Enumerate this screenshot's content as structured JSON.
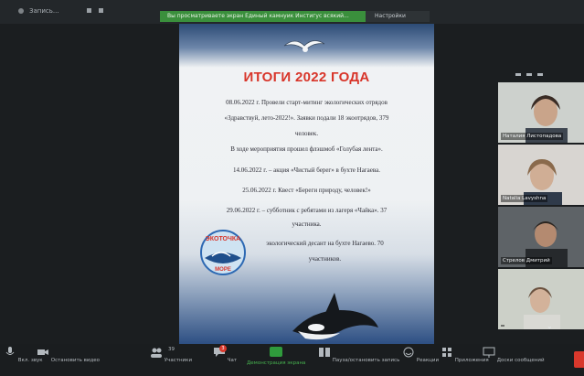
{
  "topbar": {
    "record_label": "Запись...",
    "share_banner": "Вы просматриваете экран Единый камнуик Инстигус всякий...",
    "view_options": "Настройки просмотра"
  },
  "slide": {
    "title": "ИТОГИ 2022 ГОДА",
    "lines": [
      "08.06.2022 г. Провели старт-митинг экологических отрядов",
      "«Здравствуй, лето-2022!». Заявки подали 18 экоотрядов, 379",
      "человек.",
      "В ходе мероприятия прошел флэшмоб «Голубая лента».",
      "14.06.2022 г. – акция «Чистый берег» в бухте Нагаева.",
      "25.06.2022 г. Квест «Береги природу, человек!»",
      "29.06.2022 г. – субботник с ребятами из лагеря «Чайка». 37",
      "участника.",
      "экологический десант на бухте Нагаево. 70",
      "участников."
    ],
    "logo_text_top": "ЭКОТОЧКА",
    "logo_text_bottom": "МОРЕ"
  },
  "participants": [
    {
      "name": "Наталия Листопадова"
    },
    {
      "name": "Natalia Lavyshna"
    },
    {
      "name": "Стрелов Дмитрий"
    },
    {
      "name": ""
    }
  ],
  "toolbar": {
    "mute": "Вкл. звук",
    "video": "Остановить видео",
    "participants": "Участники",
    "participants_count": "39",
    "chat": "Чат",
    "chat_badge": "3",
    "share": "Демонстрация экрана",
    "record": "Пауза/остановить запись",
    "reactions": "Реакции",
    "apps": "Приложения",
    "whiteboards": "Доски сообщений"
  },
  "colors": {
    "share_green": "#3a8f3c",
    "title_red": "#d8352a",
    "end_red": "#d9382c"
  }
}
